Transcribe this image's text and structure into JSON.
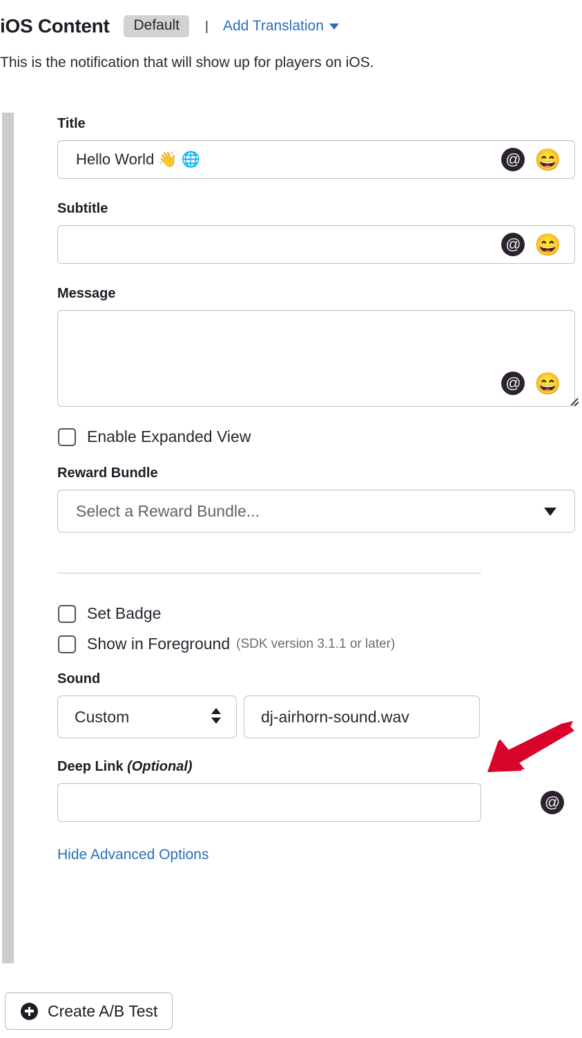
{
  "header": {
    "title": "iOS Content",
    "badge": "Default",
    "separator": "|",
    "add_translation": "Add Translation",
    "intro": "This is the notification that will show up for players on iOS."
  },
  "fields": {
    "title": {
      "label": "Title",
      "value": "Hello World 👋 🌐",
      "placeholder": "",
      "at_icon": "@",
      "emoji_icon": "😄"
    },
    "subtitle": {
      "label": "Subtitle",
      "value": "",
      "placeholder": "",
      "at_icon": "@",
      "emoji_icon": "😄"
    },
    "message": {
      "label": "Message",
      "value": "",
      "placeholder": "",
      "at_icon": "@",
      "emoji_icon": "😄"
    },
    "expanded_view": {
      "label": "Enable Expanded View",
      "checked": false
    },
    "reward_bundle": {
      "label": "Reward Bundle",
      "selected": "Select a Reward Bundle..."
    },
    "set_badge": {
      "label": "Set Badge",
      "checked": false
    },
    "show_foreground": {
      "label": "Show in Foreground",
      "note": "(SDK version 3.1.1 or later)",
      "checked": false
    },
    "sound": {
      "label": "Sound",
      "selected": "Custom",
      "file_value": "dj-airhorn-sound.wav",
      "file_placeholder": ""
    },
    "deep_link": {
      "label": "Deep Link",
      "optional": "(Optional)",
      "value": "",
      "placeholder": "",
      "at_icon": "@"
    }
  },
  "links": {
    "hide_advanced": "Hide Advanced Options"
  },
  "footer": {
    "ab_test_label": "Create A/B Test"
  },
  "colors": {
    "link": "#2a6ebb",
    "badge_bg": "#d2d2d2",
    "annotation_arrow": "#d90429",
    "icon_dark": "#2b222e",
    "rail": "#cccccc"
  }
}
